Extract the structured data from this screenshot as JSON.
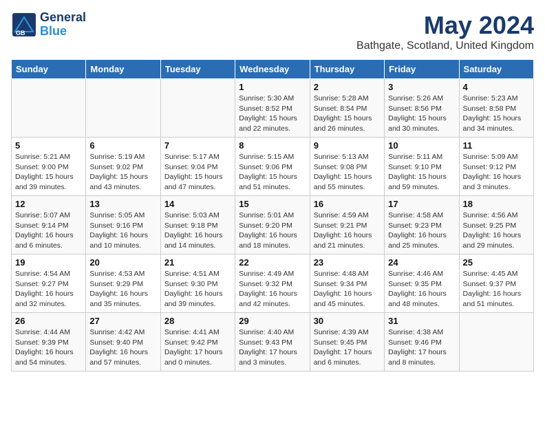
{
  "header": {
    "logo_line1": "General",
    "logo_line2": "Blue",
    "title": "May 2024",
    "subtitle": "Bathgate, Scotland, United Kingdom"
  },
  "weekdays": [
    "Sunday",
    "Monday",
    "Tuesday",
    "Wednesday",
    "Thursday",
    "Friday",
    "Saturday"
  ],
  "rows": [
    [
      {
        "num": "",
        "info": ""
      },
      {
        "num": "",
        "info": ""
      },
      {
        "num": "",
        "info": ""
      },
      {
        "num": "1",
        "info": "Sunrise: 5:30 AM\nSunset: 8:52 PM\nDaylight: 15 hours\nand 22 minutes."
      },
      {
        "num": "2",
        "info": "Sunrise: 5:28 AM\nSunset: 8:54 PM\nDaylight: 15 hours\nand 26 minutes."
      },
      {
        "num": "3",
        "info": "Sunrise: 5:26 AM\nSunset: 8:56 PM\nDaylight: 15 hours\nand 30 minutes."
      },
      {
        "num": "4",
        "info": "Sunrise: 5:23 AM\nSunset: 8:58 PM\nDaylight: 15 hours\nand 34 minutes."
      }
    ],
    [
      {
        "num": "5",
        "info": "Sunrise: 5:21 AM\nSunset: 9:00 PM\nDaylight: 15 hours\nand 39 minutes."
      },
      {
        "num": "6",
        "info": "Sunrise: 5:19 AM\nSunset: 9:02 PM\nDaylight: 15 hours\nand 43 minutes."
      },
      {
        "num": "7",
        "info": "Sunrise: 5:17 AM\nSunset: 9:04 PM\nDaylight: 15 hours\nand 47 minutes."
      },
      {
        "num": "8",
        "info": "Sunrise: 5:15 AM\nSunset: 9:06 PM\nDaylight: 15 hours\nand 51 minutes."
      },
      {
        "num": "9",
        "info": "Sunrise: 5:13 AM\nSunset: 9:08 PM\nDaylight: 15 hours\nand 55 minutes."
      },
      {
        "num": "10",
        "info": "Sunrise: 5:11 AM\nSunset: 9:10 PM\nDaylight: 15 hours\nand 59 minutes."
      },
      {
        "num": "11",
        "info": "Sunrise: 5:09 AM\nSunset: 9:12 PM\nDaylight: 16 hours\nand 3 minutes."
      }
    ],
    [
      {
        "num": "12",
        "info": "Sunrise: 5:07 AM\nSunset: 9:14 PM\nDaylight: 16 hours\nand 6 minutes."
      },
      {
        "num": "13",
        "info": "Sunrise: 5:05 AM\nSunset: 9:16 PM\nDaylight: 16 hours\nand 10 minutes."
      },
      {
        "num": "14",
        "info": "Sunrise: 5:03 AM\nSunset: 9:18 PM\nDaylight: 16 hours\nand 14 minutes."
      },
      {
        "num": "15",
        "info": "Sunrise: 5:01 AM\nSunset: 9:20 PM\nDaylight: 16 hours\nand 18 minutes."
      },
      {
        "num": "16",
        "info": "Sunrise: 4:59 AM\nSunset: 9:21 PM\nDaylight: 16 hours\nand 21 minutes."
      },
      {
        "num": "17",
        "info": "Sunrise: 4:58 AM\nSunset: 9:23 PM\nDaylight: 16 hours\nand 25 minutes."
      },
      {
        "num": "18",
        "info": "Sunrise: 4:56 AM\nSunset: 9:25 PM\nDaylight: 16 hours\nand 29 minutes."
      }
    ],
    [
      {
        "num": "19",
        "info": "Sunrise: 4:54 AM\nSunset: 9:27 PM\nDaylight: 16 hours\nand 32 minutes."
      },
      {
        "num": "20",
        "info": "Sunrise: 4:53 AM\nSunset: 9:29 PM\nDaylight: 16 hours\nand 35 minutes."
      },
      {
        "num": "21",
        "info": "Sunrise: 4:51 AM\nSunset: 9:30 PM\nDaylight: 16 hours\nand 39 minutes."
      },
      {
        "num": "22",
        "info": "Sunrise: 4:49 AM\nSunset: 9:32 PM\nDaylight: 16 hours\nand 42 minutes."
      },
      {
        "num": "23",
        "info": "Sunrise: 4:48 AM\nSunset: 9:34 PM\nDaylight: 16 hours\nand 45 minutes."
      },
      {
        "num": "24",
        "info": "Sunrise: 4:46 AM\nSunset: 9:35 PM\nDaylight: 16 hours\nand 48 minutes."
      },
      {
        "num": "25",
        "info": "Sunrise: 4:45 AM\nSunset: 9:37 PM\nDaylight: 16 hours\nand 51 minutes."
      }
    ],
    [
      {
        "num": "26",
        "info": "Sunrise: 4:44 AM\nSunset: 9:39 PM\nDaylight: 16 hours\nand 54 minutes."
      },
      {
        "num": "27",
        "info": "Sunrise: 4:42 AM\nSunset: 9:40 PM\nDaylight: 16 hours\nand 57 minutes."
      },
      {
        "num": "28",
        "info": "Sunrise: 4:41 AM\nSunset: 9:42 PM\nDaylight: 17 hours\nand 0 minutes."
      },
      {
        "num": "29",
        "info": "Sunrise: 4:40 AM\nSunset: 9:43 PM\nDaylight: 17 hours\nand 3 minutes."
      },
      {
        "num": "30",
        "info": "Sunrise: 4:39 AM\nSunset: 9:45 PM\nDaylight: 17 hours\nand 6 minutes."
      },
      {
        "num": "31",
        "info": "Sunrise: 4:38 AM\nSunset: 9:46 PM\nDaylight: 17 hours\nand 8 minutes."
      },
      {
        "num": "",
        "info": ""
      }
    ]
  ]
}
